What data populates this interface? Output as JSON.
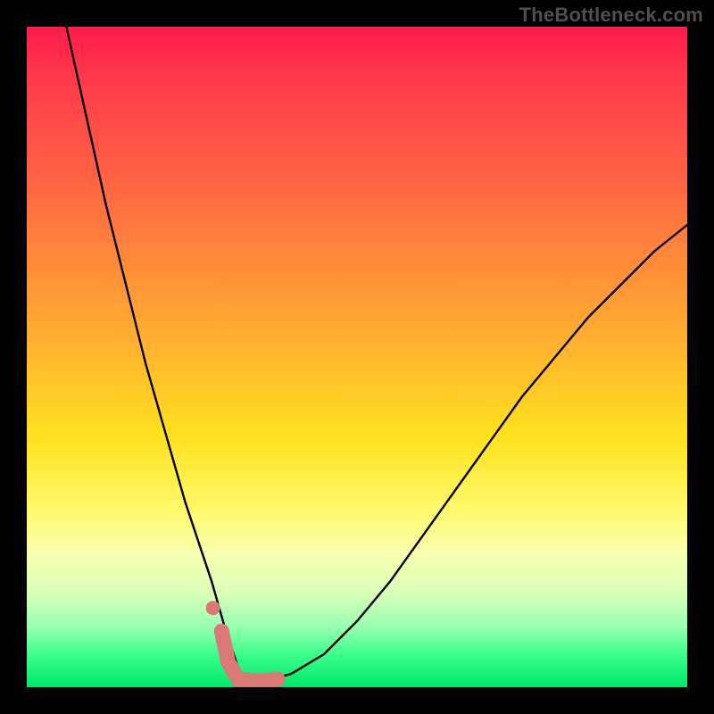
{
  "watermark": {
    "text": "TheBottleneck.com"
  },
  "colors": {
    "watermark": "#4f4f4f",
    "curve": "#000000",
    "highlight": "#d97a77",
    "gradient_top": "#ff1a4b",
    "gradient_bottom": "#00e86b"
  },
  "chart_data": {
    "type": "line",
    "title": "",
    "xlabel": "",
    "ylabel": "",
    "xlim": [
      0,
      100
    ],
    "ylim": [
      0,
      100
    ],
    "grid": false,
    "legend": false,
    "series": [
      {
        "name": "bottleneck-curve",
        "x": [
          6,
          8,
          10,
          12,
          14,
          16,
          18,
          20,
          22,
          24,
          26,
          28,
          30,
          31,
          32,
          33,
          34,
          36,
          40,
          45,
          50,
          55,
          60,
          65,
          70,
          75,
          80,
          85,
          90,
          95,
          100
        ],
        "y": [
          100,
          91,
          82,
          73,
          65,
          57,
          49,
          42,
          35,
          28,
          22,
          16,
          9,
          6,
          3,
          1.5,
          1,
          1,
          2,
          5,
          10,
          16,
          23,
          30,
          37,
          44,
          50,
          56,
          61,
          66,
          70
        ]
      }
    ],
    "highlight": {
      "name": "bottom-highlight",
      "segment_x": [
        29.5,
        30.5,
        32,
        34,
        36,
        38
      ],
      "segment_y": [
        8.5,
        3.8,
        1.2,
        1,
        1,
        1.2
      ],
      "dot": {
        "x": 28.2,
        "y": 12
      }
    },
    "notes": "Single V-shaped curve over a vertical red→green gradient; pink highlight near the trough."
  }
}
